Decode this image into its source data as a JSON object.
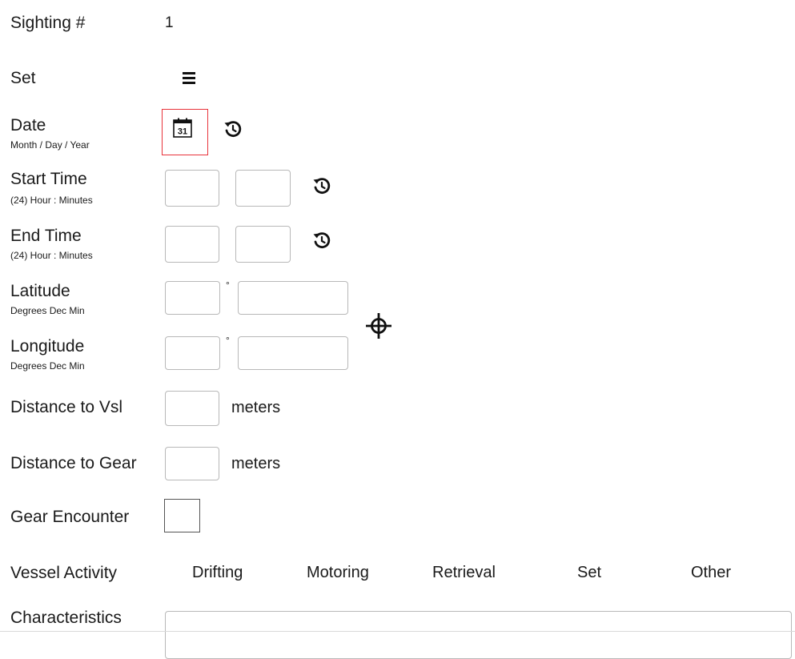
{
  "sighting": {
    "label": "Sighting #",
    "value": "1"
  },
  "set": {
    "label": "Set",
    "icon": "menu-icon"
  },
  "date": {
    "label": "Date",
    "sublabel": "Month / Day / Year",
    "calendar_icon": "calendar-icon",
    "calendar_day": "31",
    "reset_icon": "reset-icon",
    "highlight_color": "#e8333b"
  },
  "start_time": {
    "label": "Start Time",
    "sublabel": "(24) Hour : Minutes",
    "hour": "",
    "minutes": "",
    "reset_icon": "reset-icon"
  },
  "end_time": {
    "label": "End Time",
    "sublabel": "(24) Hour : Minutes",
    "hour": "",
    "minutes": "",
    "reset_icon": "reset-icon"
  },
  "latitude": {
    "label": "Latitude",
    "sublabel": "Degrees Dec Min",
    "degrees": "",
    "minutes": "",
    "degree_symbol": "°"
  },
  "longitude": {
    "label": "Longitude",
    "sublabel": "Degrees Dec Min",
    "degrees": "",
    "minutes": "",
    "degree_symbol": "°"
  },
  "gps_icon": "crosshair-icon",
  "distance_vessel": {
    "label": "Distance to Vsl",
    "value": "",
    "unit": "meters"
  },
  "distance_gear": {
    "label": "Distance to Gear",
    "value": "",
    "unit": "meters"
  },
  "gear_encounter": {
    "label": "Gear Encounter",
    "checked": false
  },
  "vessel_activity": {
    "label": "Vessel Activity",
    "options": [
      "Drifting",
      "Motoring",
      "Retrieval",
      "Set",
      "Other"
    ]
  },
  "characteristics": {
    "label": "Characteristics",
    "value": ""
  }
}
